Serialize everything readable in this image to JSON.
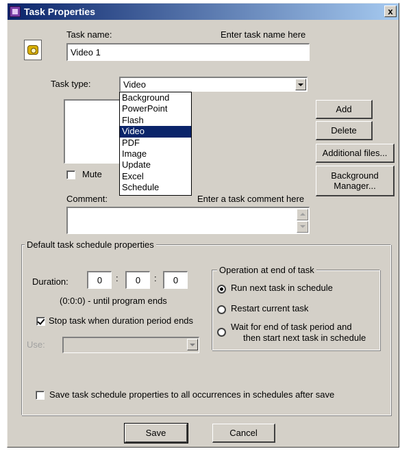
{
  "window": {
    "title": "Task Properties",
    "close_label": "x"
  },
  "task_name": {
    "label": "Task name:",
    "hint": "Enter task name here",
    "value": "Video 1"
  },
  "task_type": {
    "label": "Task type:",
    "selected": "Video",
    "options": [
      "Background",
      "PowerPoint",
      "Flash",
      "Video",
      "PDF",
      "Image",
      "Update",
      "Excel",
      "Schedule"
    ]
  },
  "buttons": {
    "add": "Add",
    "delete": "Delete",
    "additional_files": "Additional files...",
    "background_manager_line1": "Background",
    "background_manager_line2": "Manager...",
    "save": "Save",
    "cancel": "Cancel"
  },
  "mute": {
    "label": "Mute",
    "checked": false
  },
  "comment": {
    "label": "Comment:",
    "hint": "Enter a task comment here",
    "value": ""
  },
  "schedule": {
    "legend": "Default task schedule properties",
    "duration_label": "Duration:",
    "duration_hours": "0",
    "duration_minutes": "0",
    "duration_seconds": "0",
    "separator": ":",
    "duration_note": "(0:0:0) - until program ends",
    "stop_task_label": "Stop task when duration period ends",
    "stop_task_checked": true,
    "use_label": "Use:",
    "use_value": ""
  },
  "end_operation": {
    "legend": "Operation at end of task",
    "options": [
      {
        "label": "Run next task in schedule",
        "selected": true
      },
      {
        "label": "Restart current task",
        "selected": false
      },
      {
        "label_line1": "Wait for end of task period and",
        "label_line2": "then start next task in schedule",
        "selected": false
      }
    ]
  },
  "save_all": {
    "label": "Save task schedule properties to all occurrences in schedules after save",
    "checked": false
  },
  "colors": {
    "face": "#d4d0c8",
    "titlebar": "#0a246a",
    "selection": "#0a246a"
  },
  "icons": [
    "task-app-icon",
    "gear-icon",
    "close-icon"
  ]
}
